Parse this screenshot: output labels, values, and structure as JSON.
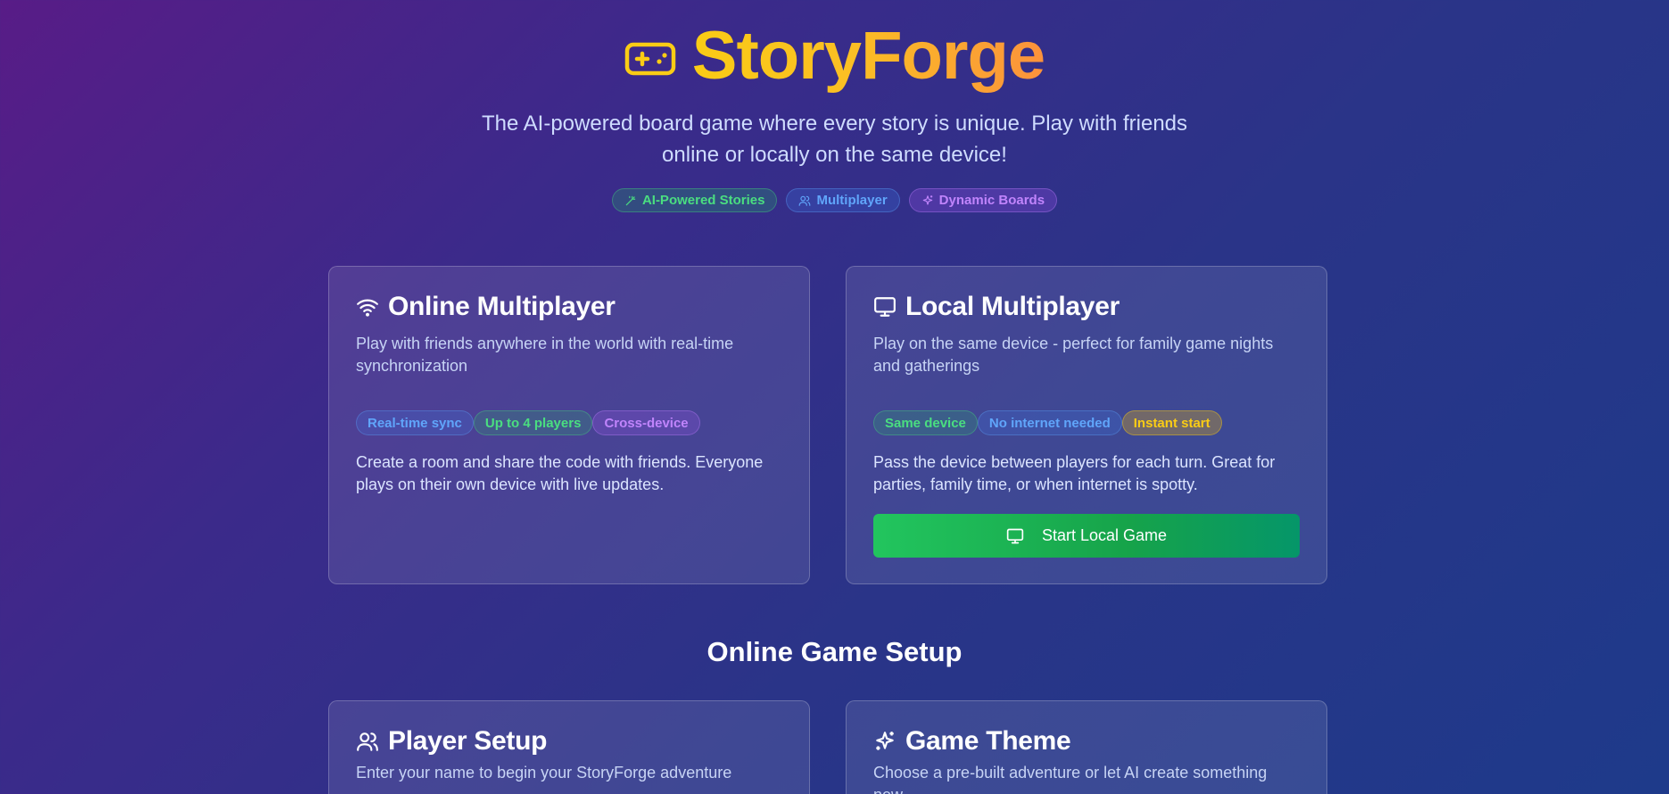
{
  "header": {
    "logo_icon": "gamepad-icon",
    "title": "StoryForge",
    "tagline_line1": "The AI-powered board game where every story is unique. Play with friends",
    "tagline_line2": "online or locally on the same device!",
    "pills": [
      {
        "label": "AI-Powered Stories",
        "icon": "wand-icon",
        "color": "#4ade80"
      },
      {
        "label": "Multiplayer",
        "icon": "users-icon",
        "color": "#60a5fa"
      },
      {
        "label": "Dynamic Boards",
        "icon": "sparkles-icon",
        "color": "#c084fc"
      }
    ]
  },
  "online_card": {
    "icon": "wifi-icon",
    "title": "Online Multiplayer",
    "description": "Play with friends anywhere in the world with real-time synchronization",
    "tags": [
      "Real-time sync",
      "Up to 4 players",
      "Cross-device"
    ],
    "body": "Create a room and share the code with friends. Everyone plays on their own device with live updates."
  },
  "local_card": {
    "icon": "monitor-icon",
    "title": "Local Multiplayer",
    "description": "Play on the same device - perfect for family game nights and gatherings",
    "tags": [
      "Same device",
      "No internet needed",
      "Instant start"
    ],
    "body": "Pass the device between players for each turn. Great for parties, family time, or when internet is spotty.",
    "button_label": "Start Local Game"
  },
  "online_setup": {
    "section_title": "Online Game Setup",
    "player_card": {
      "icon": "users-icon",
      "title": "Player Setup",
      "description": "Enter your name to begin your StoryForge adventure"
    },
    "theme_card": {
      "icon": "sparkles-icon",
      "title": "Game Theme",
      "description": "Choose a pre-built adventure or let AI create something new"
    }
  },
  "colors": {
    "accent_yellow": "#facc15",
    "accent_orange": "#fb923c",
    "button_green": "#22c55e"
  }
}
